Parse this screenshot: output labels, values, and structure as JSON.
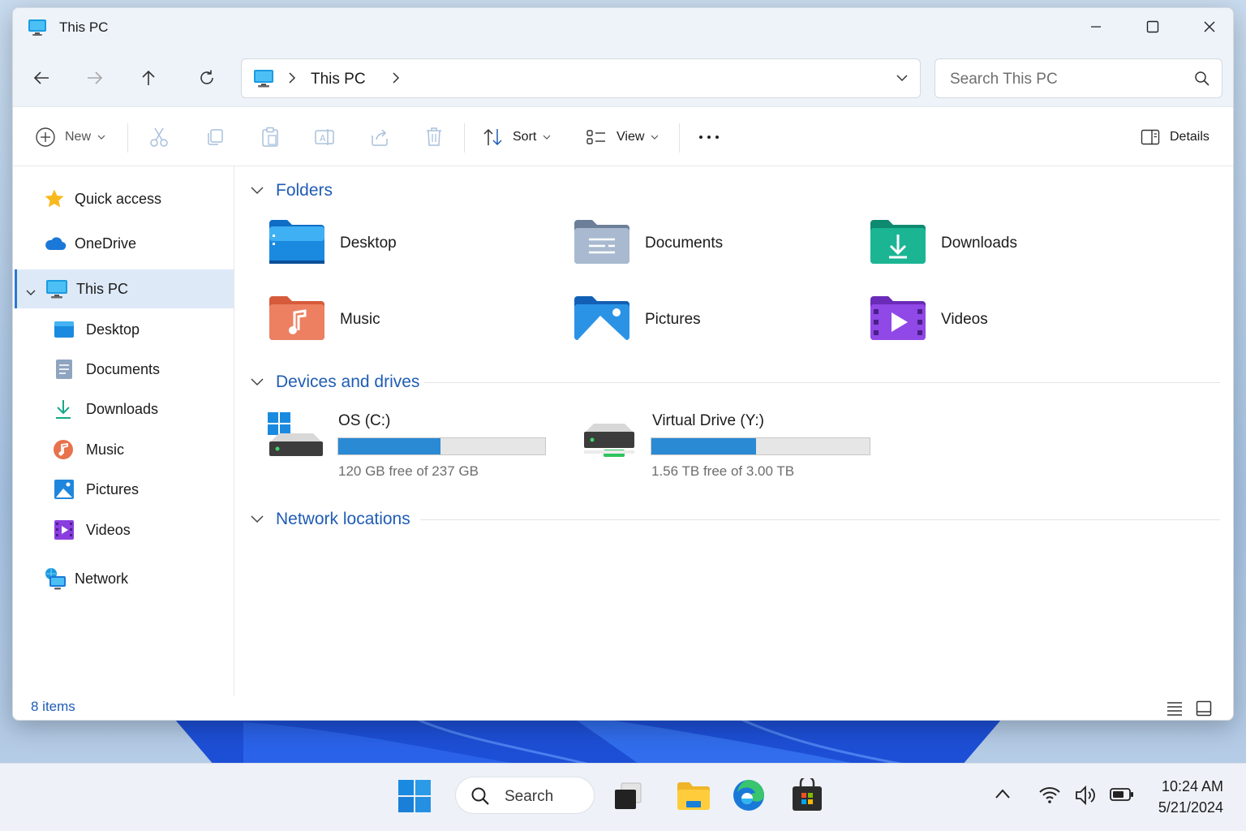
{
  "window": {
    "title": "This PC",
    "controls": [
      "minimize-icon",
      "maximize-icon",
      "close-icon"
    ]
  },
  "navigation": {
    "buttons": [
      "back-arrow-icon",
      "forward-arrow-icon",
      "up-arrow-icon",
      "refresh-icon"
    ],
    "breadcrumb": "This PC",
    "search_placeholder": "Search This PC"
  },
  "toolbar": {
    "new_label": "New",
    "sort_label": "Sort",
    "view_label": "View",
    "details_label": "Details",
    "icons": [
      "cut-icon",
      "copy-icon",
      "paste-icon",
      "rename-icon",
      "share-icon",
      "delete-icon",
      "more-icon"
    ]
  },
  "sidebar": {
    "items": [
      {
        "label": "Quick access",
        "icon": "star-icon"
      },
      {
        "label": "OneDrive",
        "icon": "cloud-icon"
      },
      {
        "label": "This PC",
        "icon": "monitor-icon"
      },
      {
        "label": "Desktop",
        "icon": "desktop-icon"
      },
      {
        "label": "Documents",
        "icon": "documents-icon"
      },
      {
        "label": "Downloads",
        "icon": "download-icon"
      },
      {
        "label": "Music",
        "icon": "music-icon"
      },
      {
        "label": "Pictures",
        "icon": "pictures-icon"
      },
      {
        "label": "Videos",
        "icon": "videos-icon"
      },
      {
        "label": "Network",
        "icon": "network-icon"
      }
    ]
  },
  "sections": {
    "folders": "Folders",
    "devices": "Devices and drives",
    "network": "Network locations"
  },
  "folders": [
    {
      "name": "Desktop",
      "color": "#1a8ae0"
    },
    {
      "name": "Documents",
      "color": "#8aa0bb"
    },
    {
      "name": "Downloads",
      "color": "#17a88a"
    },
    {
      "name": "Music",
      "color": "#e8724c"
    },
    {
      "name": "Pictures",
      "color": "#1f86dd"
    },
    {
      "name": "Videos",
      "color": "#8a3ee0"
    }
  ],
  "drives": [
    {
      "name": "OS (C:)",
      "free": "120 GB free of 237 GB",
      "used_fraction": 0.494
    },
    {
      "name": "Virtual Drive (Y:)",
      "free": "1.56 TB free of 3.00 TB",
      "used_fraction": 0.48
    }
  ],
  "status": {
    "item_count": "8 items"
  },
  "taskbar": {
    "search_label": "Search",
    "time": "10:24 AM",
    "date": "5/21/2024"
  },
  "colors": {
    "accent": "#1f5cb5",
    "selection": "#dde9f7",
    "drive_bar": "#2a8ad4"
  }
}
